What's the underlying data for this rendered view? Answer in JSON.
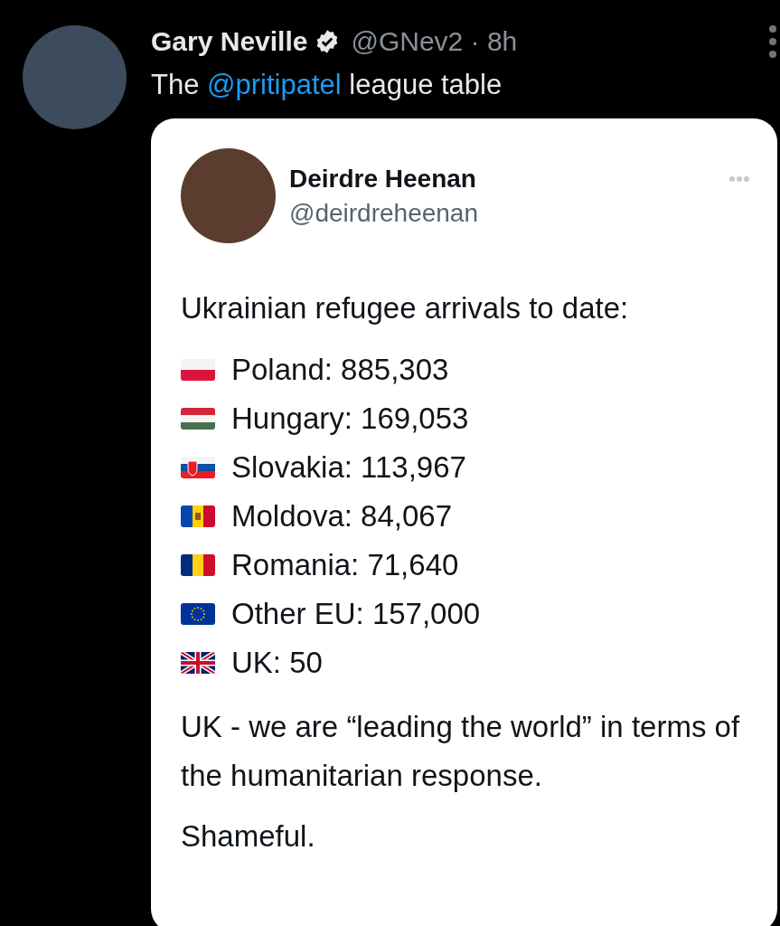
{
  "tweet": {
    "author_name": "Gary Neville",
    "verified": true,
    "meta": "@GNev2 · 8h",
    "text_parts": [
      {
        "kind": "plain",
        "text": "The "
      },
      {
        "kind": "mention",
        "text": "@pritipatel"
      },
      {
        "kind": "plain",
        "text": " league table"
      }
    ],
    "quoted": {
      "author_name": "Deirdre Heenan",
      "handle": "@deirdreheenan",
      "heading": "Ukrainian refugee arrivals to date:",
      "arrivals": [
        {
          "kind": "poland",
          "text": "Poland: 885,303"
        },
        {
          "kind": "hungary",
          "text": "Hungary: 169,053"
        },
        {
          "kind": "slovakia",
          "text": "Slovakia: 113,967"
        },
        {
          "kind": "moldova",
          "text": "Moldova: 84,067"
        },
        {
          "kind": "romania",
          "text": "Romania: 71,640"
        },
        {
          "kind": "eu",
          "text": "Other EU: 157,000"
        },
        {
          "kind": "uk",
          "text": "UK: 50"
        }
      ],
      "paragraphs": [
        "UK - we are “leading the world” in terms of the humanitarian response.",
        "Shameful."
      ]
    }
  }
}
